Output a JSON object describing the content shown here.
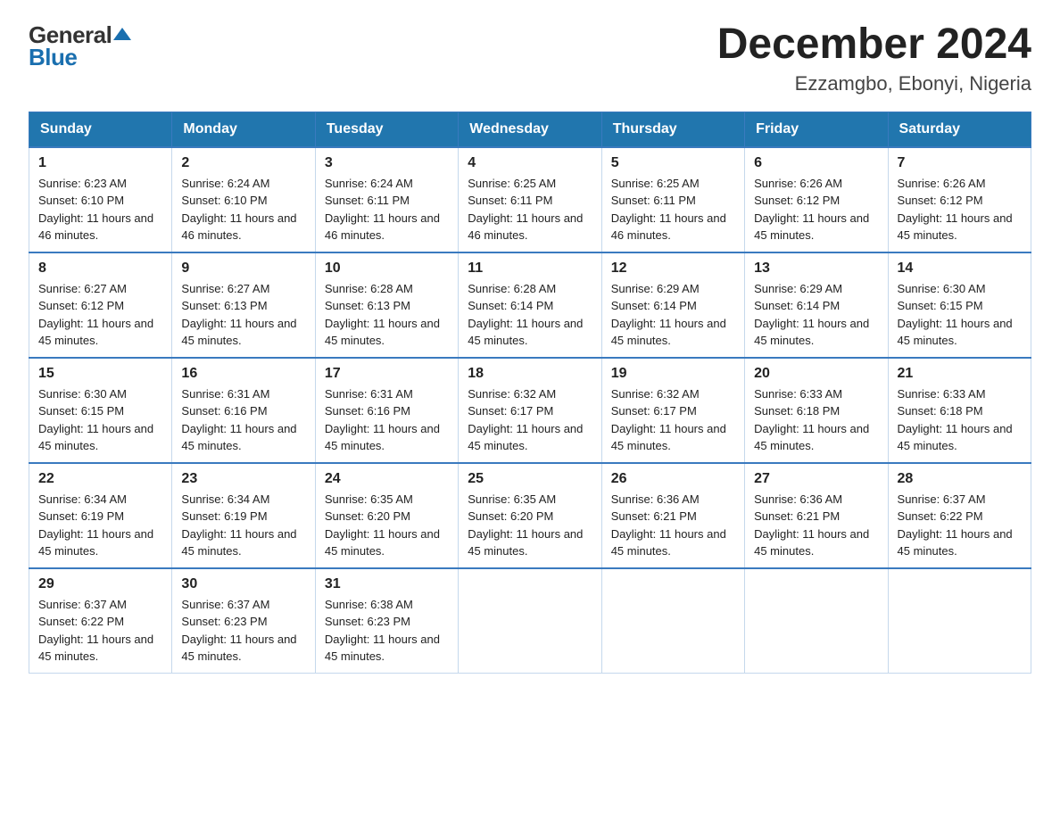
{
  "header": {
    "logo_general": "General",
    "logo_blue": "Blue",
    "month_title": "December 2024",
    "location": "Ezzamgbo, Ebonyi, Nigeria"
  },
  "weekdays": [
    "Sunday",
    "Monday",
    "Tuesday",
    "Wednesday",
    "Thursday",
    "Friday",
    "Saturday"
  ],
  "weeks": [
    [
      {
        "day": "1",
        "sunrise": "6:23 AM",
        "sunset": "6:10 PM",
        "daylight": "11 hours and 46 minutes."
      },
      {
        "day": "2",
        "sunrise": "6:24 AM",
        "sunset": "6:10 PM",
        "daylight": "11 hours and 46 minutes."
      },
      {
        "day": "3",
        "sunrise": "6:24 AM",
        "sunset": "6:11 PM",
        "daylight": "11 hours and 46 minutes."
      },
      {
        "day": "4",
        "sunrise": "6:25 AM",
        "sunset": "6:11 PM",
        "daylight": "11 hours and 46 minutes."
      },
      {
        "day": "5",
        "sunrise": "6:25 AM",
        "sunset": "6:11 PM",
        "daylight": "11 hours and 46 minutes."
      },
      {
        "day": "6",
        "sunrise": "6:26 AM",
        "sunset": "6:12 PM",
        "daylight": "11 hours and 45 minutes."
      },
      {
        "day": "7",
        "sunrise": "6:26 AM",
        "sunset": "6:12 PM",
        "daylight": "11 hours and 45 minutes."
      }
    ],
    [
      {
        "day": "8",
        "sunrise": "6:27 AM",
        "sunset": "6:12 PM",
        "daylight": "11 hours and 45 minutes."
      },
      {
        "day": "9",
        "sunrise": "6:27 AM",
        "sunset": "6:13 PM",
        "daylight": "11 hours and 45 minutes."
      },
      {
        "day": "10",
        "sunrise": "6:28 AM",
        "sunset": "6:13 PM",
        "daylight": "11 hours and 45 minutes."
      },
      {
        "day": "11",
        "sunrise": "6:28 AM",
        "sunset": "6:14 PM",
        "daylight": "11 hours and 45 minutes."
      },
      {
        "day": "12",
        "sunrise": "6:29 AM",
        "sunset": "6:14 PM",
        "daylight": "11 hours and 45 minutes."
      },
      {
        "day": "13",
        "sunrise": "6:29 AM",
        "sunset": "6:14 PM",
        "daylight": "11 hours and 45 minutes."
      },
      {
        "day": "14",
        "sunrise": "6:30 AM",
        "sunset": "6:15 PM",
        "daylight": "11 hours and 45 minutes."
      }
    ],
    [
      {
        "day": "15",
        "sunrise": "6:30 AM",
        "sunset": "6:15 PM",
        "daylight": "11 hours and 45 minutes."
      },
      {
        "day": "16",
        "sunrise": "6:31 AM",
        "sunset": "6:16 PM",
        "daylight": "11 hours and 45 minutes."
      },
      {
        "day": "17",
        "sunrise": "6:31 AM",
        "sunset": "6:16 PM",
        "daylight": "11 hours and 45 minutes."
      },
      {
        "day": "18",
        "sunrise": "6:32 AM",
        "sunset": "6:17 PM",
        "daylight": "11 hours and 45 minutes."
      },
      {
        "day": "19",
        "sunrise": "6:32 AM",
        "sunset": "6:17 PM",
        "daylight": "11 hours and 45 minutes."
      },
      {
        "day": "20",
        "sunrise": "6:33 AM",
        "sunset": "6:18 PM",
        "daylight": "11 hours and 45 minutes."
      },
      {
        "day": "21",
        "sunrise": "6:33 AM",
        "sunset": "6:18 PM",
        "daylight": "11 hours and 45 minutes."
      }
    ],
    [
      {
        "day": "22",
        "sunrise": "6:34 AM",
        "sunset": "6:19 PM",
        "daylight": "11 hours and 45 minutes."
      },
      {
        "day": "23",
        "sunrise": "6:34 AM",
        "sunset": "6:19 PM",
        "daylight": "11 hours and 45 minutes."
      },
      {
        "day": "24",
        "sunrise": "6:35 AM",
        "sunset": "6:20 PM",
        "daylight": "11 hours and 45 minutes."
      },
      {
        "day": "25",
        "sunrise": "6:35 AM",
        "sunset": "6:20 PM",
        "daylight": "11 hours and 45 minutes."
      },
      {
        "day": "26",
        "sunrise": "6:36 AM",
        "sunset": "6:21 PM",
        "daylight": "11 hours and 45 minutes."
      },
      {
        "day": "27",
        "sunrise": "6:36 AM",
        "sunset": "6:21 PM",
        "daylight": "11 hours and 45 minutes."
      },
      {
        "day": "28",
        "sunrise": "6:37 AM",
        "sunset": "6:22 PM",
        "daylight": "11 hours and 45 minutes."
      }
    ],
    [
      {
        "day": "29",
        "sunrise": "6:37 AM",
        "sunset": "6:22 PM",
        "daylight": "11 hours and 45 minutes."
      },
      {
        "day": "30",
        "sunrise": "6:37 AM",
        "sunset": "6:23 PM",
        "daylight": "11 hours and 45 minutes."
      },
      {
        "day": "31",
        "sunrise": "6:38 AM",
        "sunset": "6:23 PM",
        "daylight": "11 hours and 45 minutes."
      },
      null,
      null,
      null,
      null
    ]
  ]
}
